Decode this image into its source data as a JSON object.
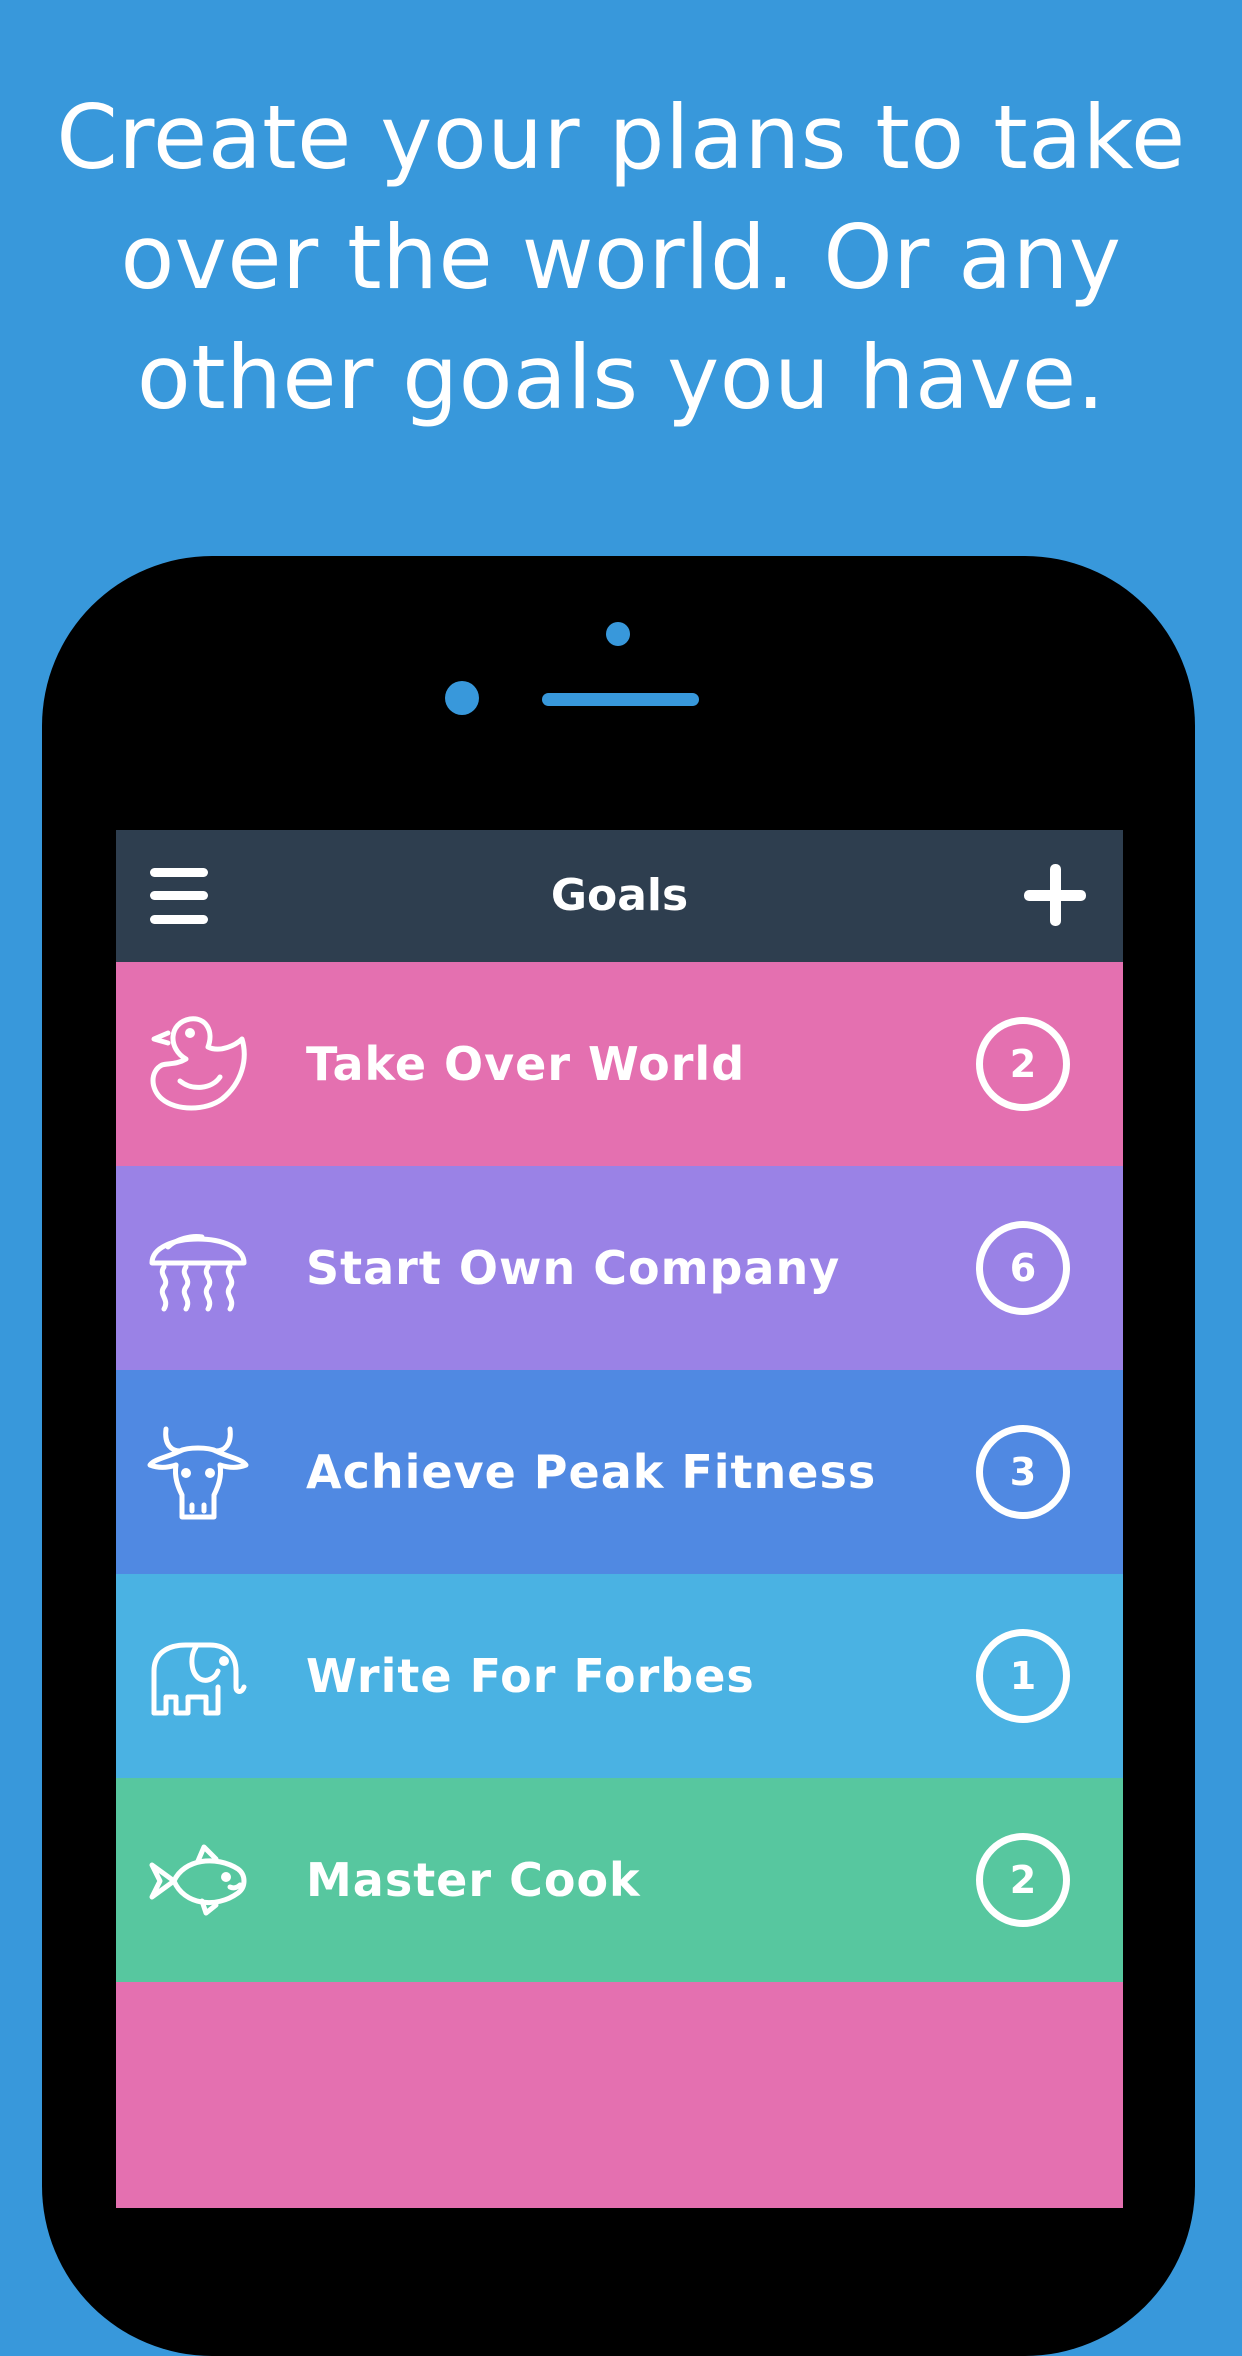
{
  "headline": "Create your plans to take over the world. Or any other goals you have.",
  "app": {
    "title": "Goals",
    "menu_icon": "hamburger-menu-icon",
    "add_icon": "plus-icon"
  },
  "goals": [
    {
      "title": "Take Over World",
      "count": "2",
      "icon": "duck-icon",
      "color": "#e470b0"
    },
    {
      "title": "Start Own Company",
      "count": "6",
      "icon": "jellyfish-icon",
      "color": "#9a82e6"
    },
    {
      "title": "Achieve Peak Fitness",
      "count": "3",
      "icon": "cow-icon",
      "color": "#5089e2"
    },
    {
      "title": "Write For Forbes",
      "count": "1",
      "icon": "elephant-icon",
      "color": "#4ab2e3"
    },
    {
      "title": "Master Cook",
      "count": "2",
      "icon": "fish-icon",
      "color": "#57c79f"
    }
  ],
  "colors": {
    "background": "#3898db",
    "navbar": "#2e3e4f",
    "empty_area": "#e470b0",
    "phone_body": "#000000"
  }
}
